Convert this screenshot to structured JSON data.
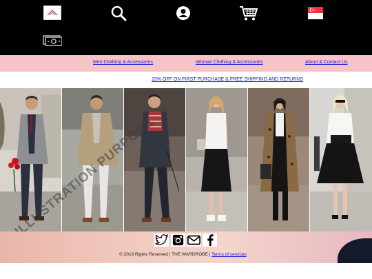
{
  "header": {
    "icons": {
      "logo": "logo-icon",
      "search": "search-icon",
      "account": "account-icon",
      "cart": "cart-icon",
      "flag": "singapore-flag-icon",
      "currency": "currency-icon"
    }
  },
  "nav": {
    "men": "Men Clothing & Accessories",
    "women": "Woman Clothing & Accessories",
    "about": "About & Contact Us"
  },
  "promo": {
    "text": "15% OFF ON FIRST PURCHASE & FREE SHIPPING AND RETURNS"
  },
  "hero": {
    "watermark": "FOR ILLUSTRATION PURPOSE"
  },
  "footer": {
    "copyright": "© 2018 Rights Reserved | THE WARDROBE | ",
    "terms": "Terms of services",
    "social": [
      "twitter-icon",
      "instagram-icon",
      "mail-icon",
      "facebook-icon"
    ]
  },
  "colors": {
    "header_bg": "#000000",
    "nav_bg": "#f6c3c7",
    "link": "#1a1ad8"
  }
}
